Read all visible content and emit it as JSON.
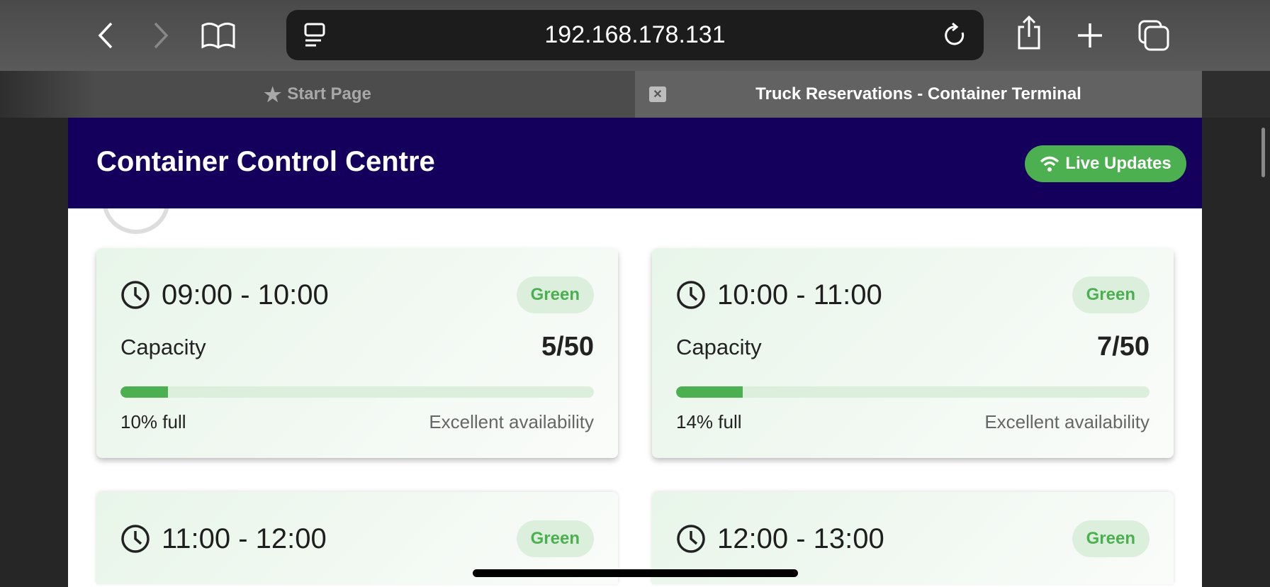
{
  "browser": {
    "url": "192.168.178.131",
    "tabs": [
      {
        "label": "Start Page",
        "icon": "star-icon"
      },
      {
        "label": "Truck Reservations - Container Terminal",
        "icon": "close-icon"
      }
    ]
  },
  "header": {
    "title": "Container Control Centre",
    "live_label": "Live Updates"
  },
  "colors": {
    "header": "#14005c",
    "accent": "#4caf50"
  },
  "slots": [
    {
      "time": "09:00 - 10:00",
      "status": "Green",
      "capacity_label": "Capacity",
      "capacity": "5/50",
      "fill_percent": 10,
      "percent_label": "10% full",
      "availability": "Excellent availability"
    },
    {
      "time": "10:00 - 11:00",
      "status": "Green",
      "capacity_label": "Capacity",
      "capacity": "7/50",
      "fill_percent": 14,
      "percent_label": "14% full",
      "availability": "Excellent availability"
    },
    {
      "time": "11:00 - 12:00",
      "status": "Green"
    },
    {
      "time": "12:00 - 13:00",
      "status": "Green"
    }
  ]
}
